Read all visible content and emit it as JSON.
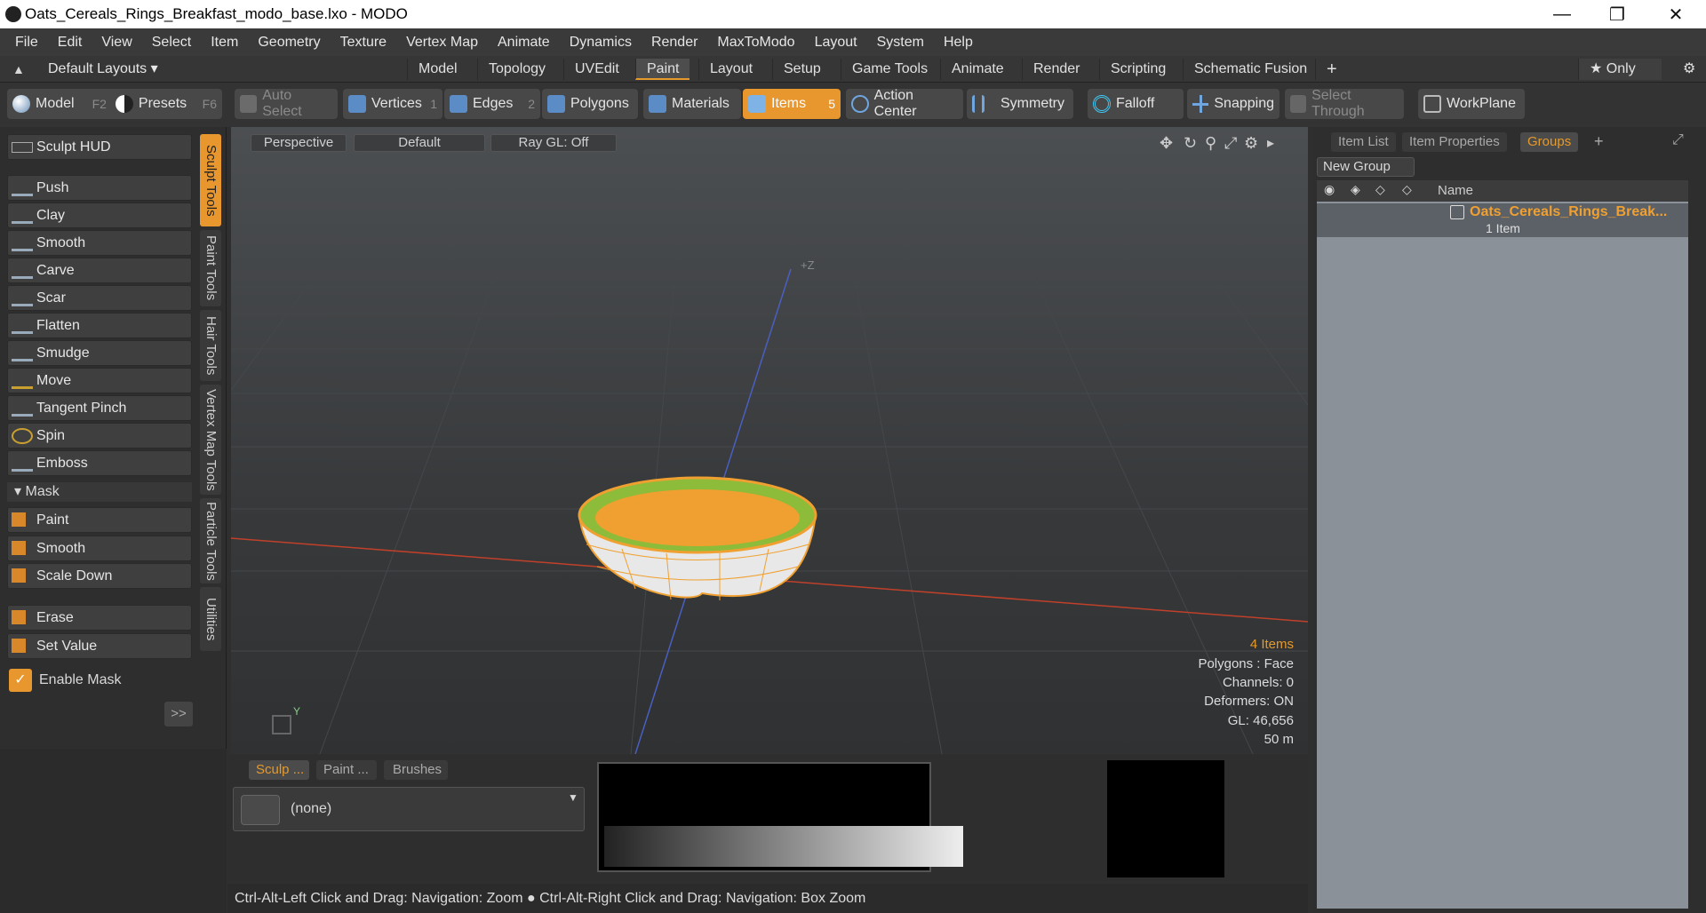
{
  "window": {
    "title": "Oats_Cereals_Rings_Breakfast_modo_base.lxo - MODO",
    "minimize": "—",
    "restore": "❐",
    "close": "✕"
  },
  "menu": [
    "File",
    "Edit",
    "View",
    "Select",
    "Item",
    "Geometry",
    "Texture",
    "Vertex Map",
    "Animate",
    "Dynamics",
    "Render",
    "MaxToModo",
    "Layout",
    "System",
    "Help"
  ],
  "layoutbar": {
    "layouts_label": "Default Layouts ▾",
    "tabs": [
      "Model",
      "Topology",
      "UVEdit",
      "Paint",
      "Layout",
      "Setup",
      "Game Tools",
      "Animate",
      "Render",
      "Scripting",
      "Schematic Fusion"
    ],
    "active_tab": "Paint",
    "add": "+",
    "only": "★  Only",
    "gear": "⚙"
  },
  "toolbar": {
    "model": "Model",
    "model_key": "F2",
    "presets": "Presets",
    "presets_key": "F6",
    "auto_select": "Auto Select",
    "vertices": "Vertices",
    "vertices_key": "1",
    "edges": "Edges",
    "edges_key": "2",
    "polygons": "Polygons",
    "materials": "Materials",
    "items": "Items",
    "items_key": "5",
    "action_center": "Action Center",
    "symmetry": "Symmetry",
    "falloff": "Falloff",
    "snapping": "Snapping",
    "select_through": "Select Through",
    "workplane": "WorkPlane"
  },
  "left": {
    "sculpt_hud": "Sculpt HUD",
    "tools": [
      "Push",
      "Clay",
      "Smooth",
      "Carve",
      "Scar",
      "Flatten",
      "Smudge",
      "Move",
      "Tangent Pinch",
      "Spin",
      "Emboss"
    ],
    "mask_header": "Mask",
    "mask_tools": [
      "Paint",
      "Smooth",
      "Scale Down"
    ],
    "erase": "Erase",
    "set_value": "Set Value",
    "enable_mask": "Enable Mask",
    "expand": ">>",
    "vtabs": [
      "Sculpt Tools",
      "Paint Tools",
      "Hair Tools",
      "Vertex Map Tools",
      "Particle Tools",
      "Utilities"
    ]
  },
  "viewport": {
    "perspective": "Perspective",
    "default": "Default",
    "raygl": "Ray GL: Off",
    "axis_z": "+Z",
    "axis_y": "Y",
    "stats": [
      "4 Items",
      "Polygons : Face",
      "Channels: 0",
      "Deformers: ON",
      "GL: 46,656",
      "50 m"
    ]
  },
  "right": {
    "tabs": [
      "Item List",
      "Item Properties",
      "Groups"
    ],
    "active": "Groups",
    "add": "+",
    "new_group": "New Group",
    "col_name": "Name",
    "group_name": "Oats_Cereals_Rings_Break...",
    "group_count": "1 Item"
  },
  "bottom": {
    "tabs": [
      "Sculp ...",
      "Paint ...",
      "Brushes"
    ],
    "brush_value": "(none)"
  },
  "status": "Ctrl-Alt-Left Click and Drag: Navigation: Zoom ● Ctrl-Alt-Right Click and Drag: Navigation: Box Zoom",
  "colors": {
    "accent": "#e59a2b",
    "bowl": "#f0a030",
    "leaf": "#8dbb3a"
  }
}
